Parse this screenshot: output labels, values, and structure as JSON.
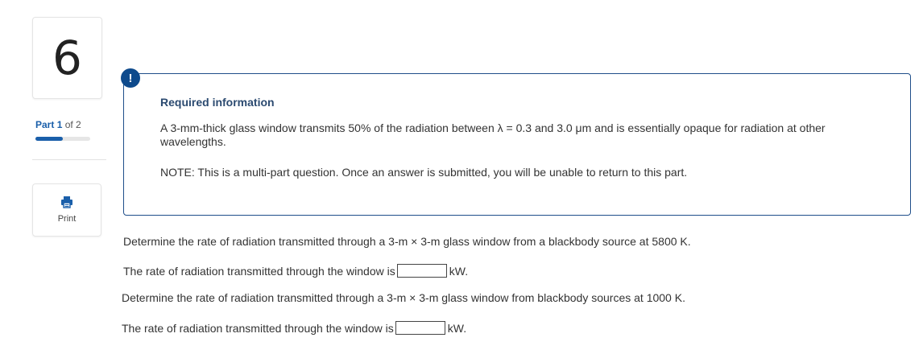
{
  "question": {
    "number": "6"
  },
  "part": {
    "label": "Part",
    "current": "1",
    "of_text": "of 2",
    "progress": 0.5
  },
  "print": {
    "label": "Print",
    "icon": "printer-icon"
  },
  "alert": {
    "symbol": "!",
    "icon": "alert-icon"
  },
  "info": {
    "title": "Required information",
    "body": "A 3-mm-thick glass window transmits 50% of the radiation between λ = 0.3 and 3.0 μm and is essentially opaque for radiation at other wavelengths.",
    "note": "NOTE: This is a multi-part question. Once an answer is submitted, you will be unable to return to this part."
  },
  "questions": [
    {
      "prompt": "Determine the rate of radiation transmitted through a 3-m × 3-m glass window from a blackbody source at 5800 K.",
      "answer_label": "The rate of radiation transmitted through the window is",
      "answer_value": "",
      "unit": "kW."
    },
    {
      "prompt": "Determine the rate of radiation transmitted through a 3-m × 3-m glass window from blackbody sources at 1000 K.",
      "answer_label": "The rate of radiation transmitted through the window is",
      "answer_value": "",
      "unit": "kW."
    }
  ],
  "colors": {
    "accent": "#1a5faa",
    "box_border": "#1f4e8a",
    "badge": "#0e4a8c"
  }
}
